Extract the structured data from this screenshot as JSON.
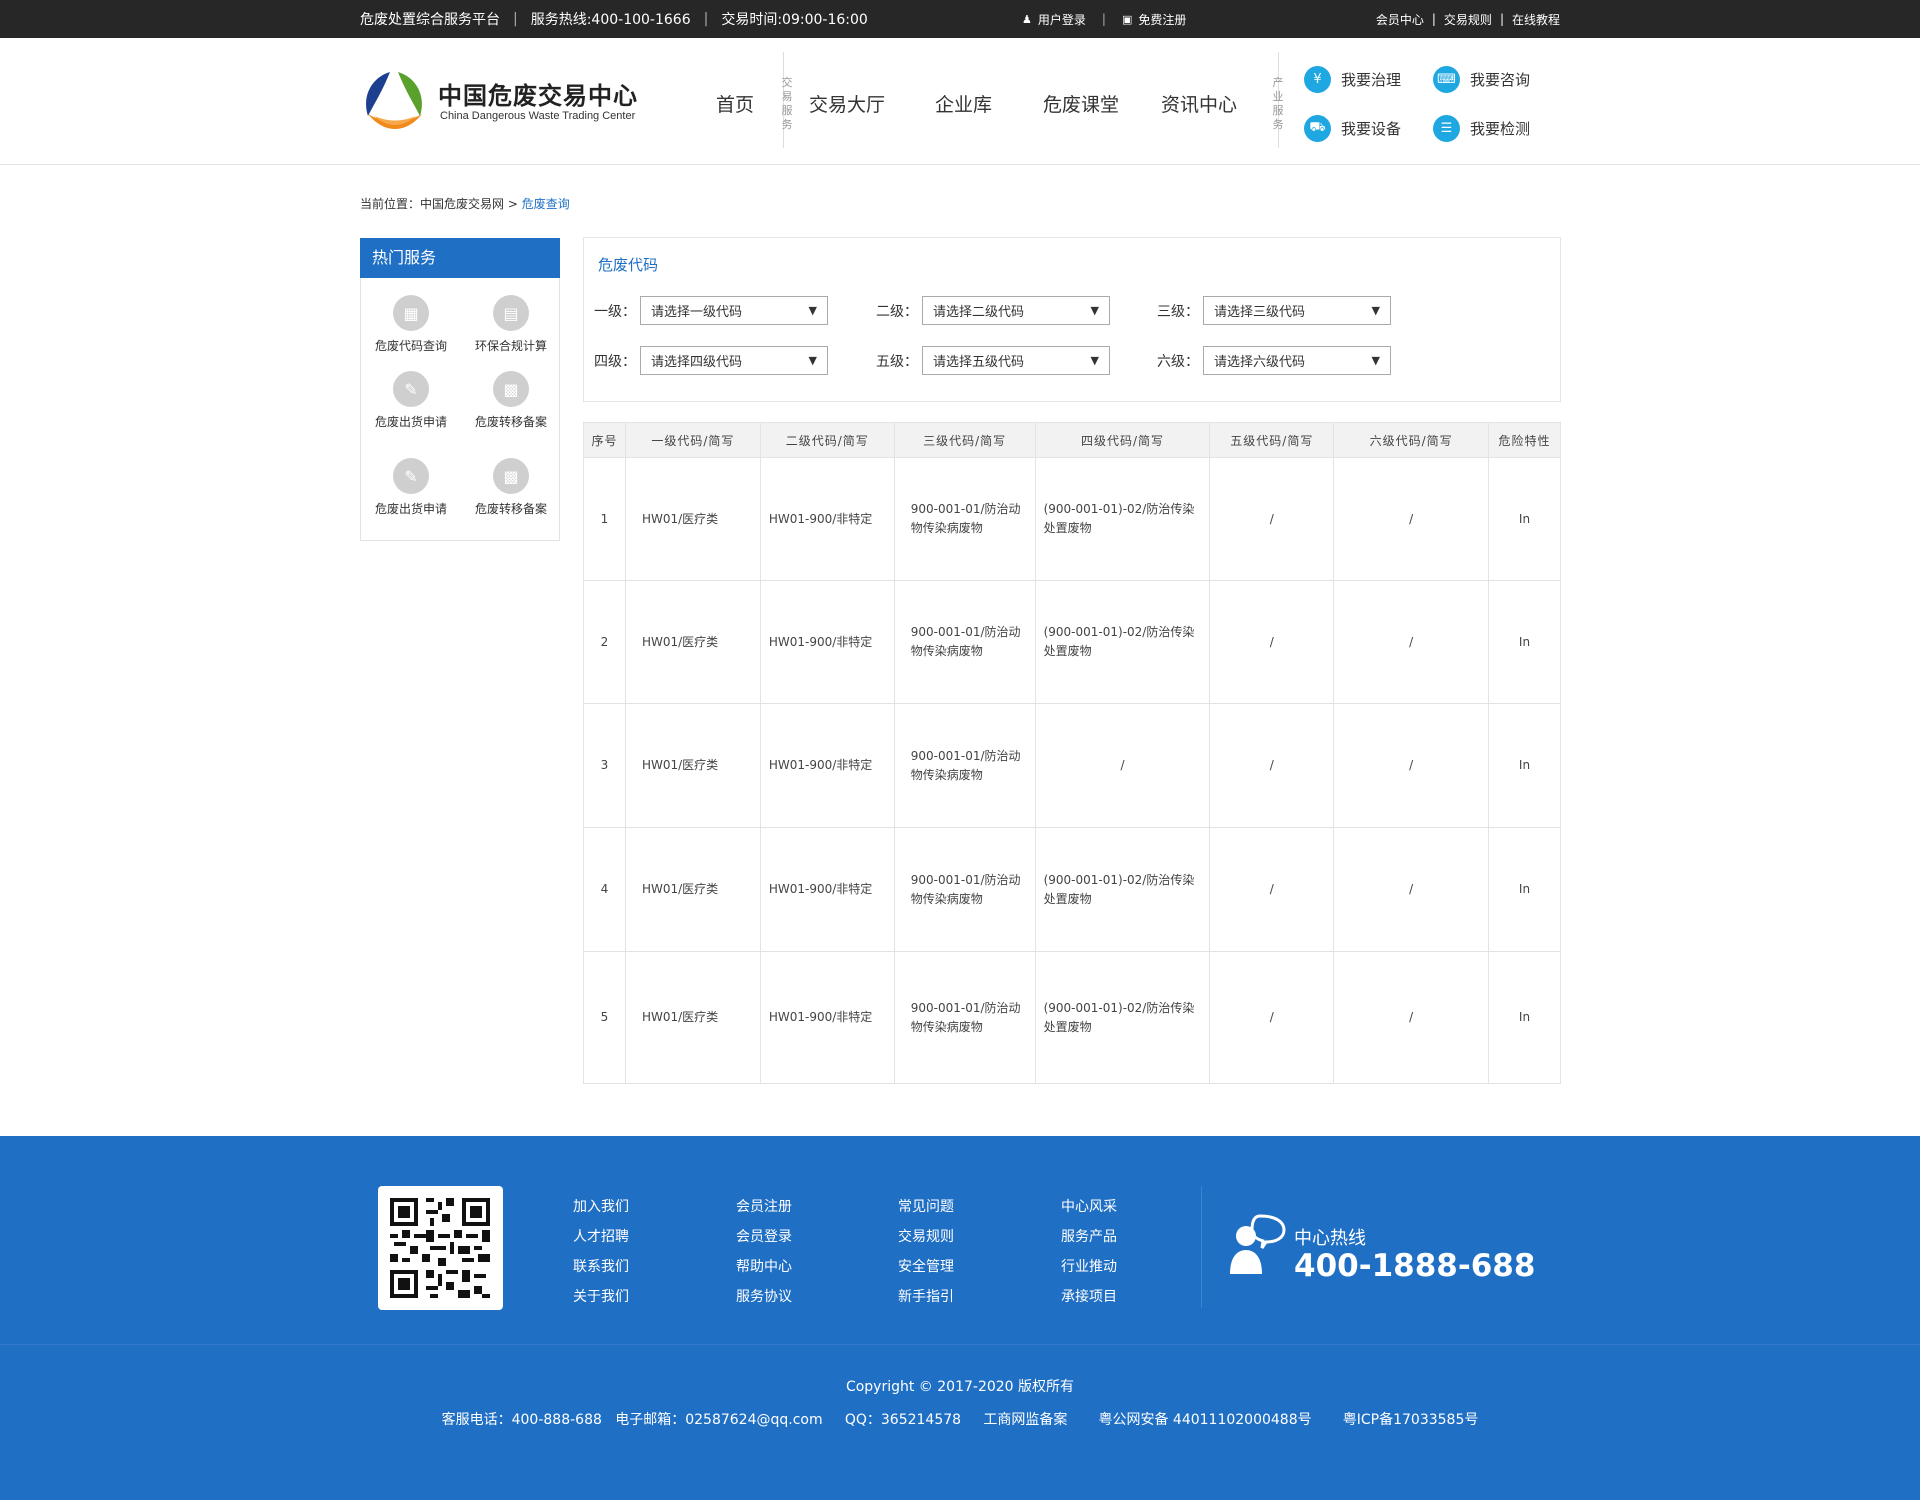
{
  "topbar": {
    "platform": "危废处置综合服务平台",
    "hotline": "服务热线:400-100-1666",
    "hours": "交易时间:09:00-16:00",
    "login": "用户登录",
    "register": "免费注册",
    "member_center": "会员中心",
    "trade_rules": "交易规则",
    "tutorial": "在线教程"
  },
  "logo": {
    "cn": "中国危废交易中心",
    "en": "China Dangerous Waste Trading Center"
  },
  "nav": {
    "home": "首页",
    "tag_trade": "交易服务",
    "hall": "交易大厅",
    "enterprise": "企业库",
    "classroom": "危废课堂",
    "news": "资讯中心",
    "tag_industry": "产业服务"
  },
  "services": [
    "我要治理",
    "我要咨询",
    "我要设备",
    "我要检测"
  ],
  "breadcrumb": {
    "prefix": "当前位置：",
    "site": "中国危废交易网",
    "sep": ">",
    "current": "危废查询"
  },
  "sidebar": {
    "title": "热门服务",
    "items": [
      "危废代码查询",
      "环保合规计算",
      "危废出货申请",
      "危废转移备案",
      "危废出货申请",
      "危废转移备案"
    ]
  },
  "filter": {
    "title": "危废代码",
    "fields": [
      {
        "label": "一级：",
        "placeholder": "请选择一级代码"
      },
      {
        "label": "二级：",
        "placeholder": "请选择二级代码"
      },
      {
        "label": "三级：",
        "placeholder": "请选择三级代码"
      },
      {
        "label": "四级：",
        "placeholder": "请选择四级代码"
      },
      {
        "label": "五级：",
        "placeholder": "请选择五级代码"
      },
      {
        "label": "六级：",
        "placeholder": "请选择六级代码"
      }
    ]
  },
  "table": {
    "headers": [
      "序号",
      "一级代码/简写",
      "二级代码/简写",
      "三级代码/简写",
      "四级代码/简写",
      "五级代码/简写",
      "六级代码/简写",
      "危险特性"
    ],
    "rows": [
      [
        "1",
        "HW01/医疗类",
        "HW01-900/非特定",
        "900-001-01/防治动物传染病废物",
        "(900-001-01)-02/防治传染处置废物",
        "/",
        "/",
        "In"
      ],
      [
        "2",
        "HW01/医疗类",
        "HW01-900/非特定",
        "900-001-01/防治动物传染病废物",
        "(900-001-01)-02/防治传染处置废物",
        "/",
        "/",
        "In"
      ],
      [
        "3",
        "HW01/医疗类",
        "HW01-900/非特定",
        "900-001-01/防治动物传染病废物",
        "/",
        "/",
        "/",
        "In"
      ],
      [
        "4",
        "HW01/医疗类",
        "HW01-900/非特定",
        "900-001-01/防治动物传染病废物",
        "(900-001-01)-02/防治传染处置废物",
        "/",
        "/",
        "In"
      ],
      [
        "5",
        "HW01/医疗类",
        "HW01-900/非特定",
        "900-001-01/防治动物传染病废物",
        "(900-001-01)-02/防治传染处置废物",
        "/",
        "/",
        "In"
      ]
    ]
  },
  "footer": {
    "cols": [
      [
        "加入我们",
        "人才招聘",
        "联系我们",
        "关于我们"
      ],
      [
        "会员注册",
        "会员登录",
        "帮助中心",
        "服务协议"
      ],
      [
        "常见问题",
        "交易规则",
        "安全管理",
        "新手指引"
      ],
      [
        "中心风采",
        "服务产品",
        "行业推动",
        "承接项目"
      ]
    ],
    "hotline_label": "中心热线",
    "hotline_number": "400-1888-688",
    "copyright": "Copyright © 2017-2020  版权所有",
    "contact": "客服电话：400-888-688   电子邮箱：02587624@qq.com     QQ：365214578     工商网监备案       粤公网安备 44011102000488号       粤ICP备17033585号"
  },
  "colors": {
    "brand_blue": "#1f6fc5",
    "topbar_bg": "#272727",
    "icon_cyan": "#1fa7e2"
  }
}
